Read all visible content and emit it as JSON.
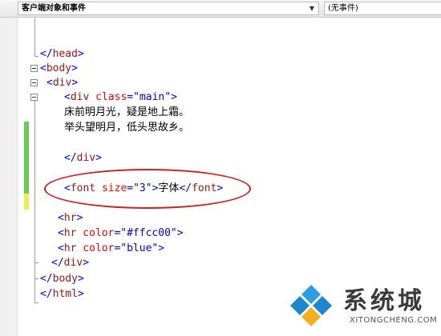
{
  "toolbar": {
    "client_objects_label": "客户端对象和事件",
    "events_label": "(无事件)"
  },
  "code": {
    "l1": {
      "open": "</",
      "tag": "head",
      "close": ">"
    },
    "l2": {
      "open": "<",
      "tag": "body",
      "close": ">"
    },
    "l3": {
      "open": "<",
      "tag": "div",
      "close": ">"
    },
    "l4": {
      "open": "<",
      "tag": "div",
      "attr": " class",
      "eq": "=",
      "val": "\"main\"",
      "close": ">"
    },
    "l5": "床前明月光，疑是地上霜。",
    "l6": "举头望明月，低头思故乡。",
    "l7": {
      "open": "</",
      "tag": "div",
      "close": ">"
    },
    "l8": {
      "open": "<",
      "tag": "font",
      "attr": " size",
      "eq": "=",
      "val": "\"3\"",
      "close": ">",
      "text": "字体",
      "end_open": "</",
      "end_tag": "font",
      "end_close": ">"
    },
    "l9": {
      "open": "<",
      "tag": "hr",
      "close": ">"
    },
    "l10": {
      "open": "<",
      "tag": "hr",
      "attr": " color",
      "eq": "=",
      "val": "\"#ffcc00\"",
      "close": ">"
    },
    "l11": {
      "open": "<",
      "tag": "hr",
      "attr": " color",
      "eq": "=",
      "val": "\"blue\"",
      "close": ">"
    },
    "l12": {
      "open": "</",
      "tag": "div",
      "close": ">"
    },
    "l13": {
      "open": "</",
      "tag": "body",
      "close": ">"
    },
    "l14": {
      "open": "</",
      "tag": "html",
      "close": ">"
    }
  },
  "watermark": {
    "name": "系统城",
    "domain": "XITONGCHENG.COM"
  },
  "colors": {
    "tag": "#a31515",
    "bracket": "#0000ff",
    "attribute": "#ff0000",
    "value": "#0000ff",
    "highlight_ellipse": "#cc2222"
  }
}
